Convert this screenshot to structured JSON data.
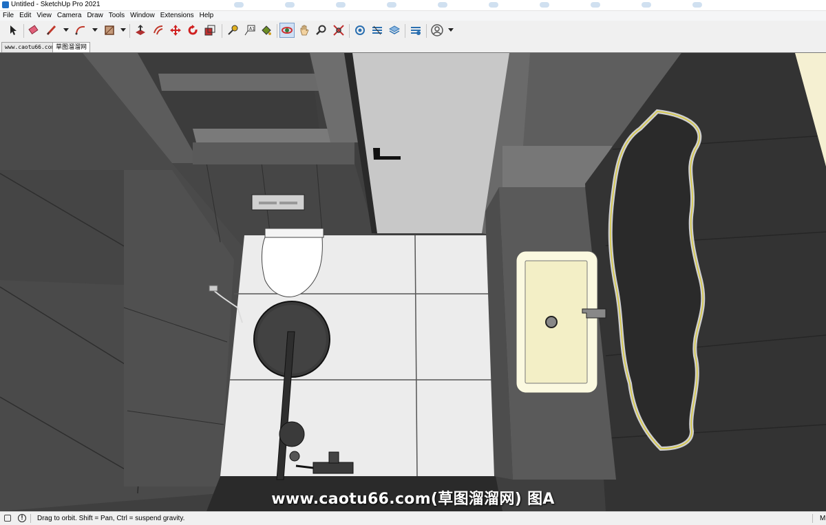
{
  "window": {
    "title": "Untitled - SketchUp Pro 2021"
  },
  "menu": [
    "File",
    "Edit",
    "View",
    "Camera",
    "Draw",
    "Tools",
    "Window",
    "Extensions",
    "Help"
  ],
  "toolbar": {
    "tools": [
      {
        "name": "select-tool-icon",
        "color": "#222222"
      },
      {
        "name": "eraser-tool-icon",
        "color": "#e0607a"
      },
      {
        "name": "line-tool-icon",
        "color": "#c0392b"
      },
      {
        "name": "arc-tool-icon",
        "color": "#c0392b"
      },
      {
        "name": "rectangle-tool-icon",
        "color": "#8b5a3c"
      },
      {
        "name": "push-pull-tool-icon",
        "color": "#b03030"
      },
      {
        "name": "offset-tool-icon",
        "color": "#c0392b"
      },
      {
        "name": "move-tool-icon",
        "color": "#d02020"
      },
      {
        "name": "rotate-tool-icon",
        "color": "#d02020"
      },
      {
        "name": "scale-tool-icon",
        "color": "#c03030"
      },
      {
        "name": "tape-measure-tool-icon",
        "color": "#b8860b"
      },
      {
        "name": "text-tool-icon",
        "color": "#333333"
      },
      {
        "name": "paint-bucket-tool-icon",
        "color": "#6b8e23"
      },
      {
        "name": "orbit-tool-icon",
        "color": "#d03030"
      },
      {
        "name": "pan-tool-icon",
        "color": "#d8a860"
      },
      {
        "name": "zoom-tool-icon",
        "color": "#333333"
      },
      {
        "name": "zoom-extents-tool-icon",
        "color": "#c03030"
      },
      {
        "name": "warehouse-icon",
        "color": "#2a6fb0"
      },
      {
        "name": "extension-warehouse-icon",
        "color": "#2a6fb0"
      },
      {
        "name": "layout-icon",
        "color": "#2a6fb0"
      },
      {
        "name": "extension-manager-icon",
        "color": "#2a6fb0"
      },
      {
        "name": "account-icon",
        "color": "#555555"
      }
    ],
    "active_tool": "orbit-tool-icon"
  },
  "tabs": [
    "www.caotu66.com",
    "草图溜溜网"
  ],
  "active_tab": 1,
  "viewport": {
    "watermark": "www.caotu66.com(草图溜溜网) 图A",
    "colors": {
      "wall": "#4a4a4a",
      "floor": "#ececec",
      "door": "#c8c8c8",
      "counter": "#5a5a5a",
      "sink": "#fbf9e0",
      "mirror_edge": "#d8c838"
    }
  },
  "status": {
    "message": "Drag to orbit. Shift = Pan, Ctrl = suspend gravity.",
    "right_label": "M"
  }
}
